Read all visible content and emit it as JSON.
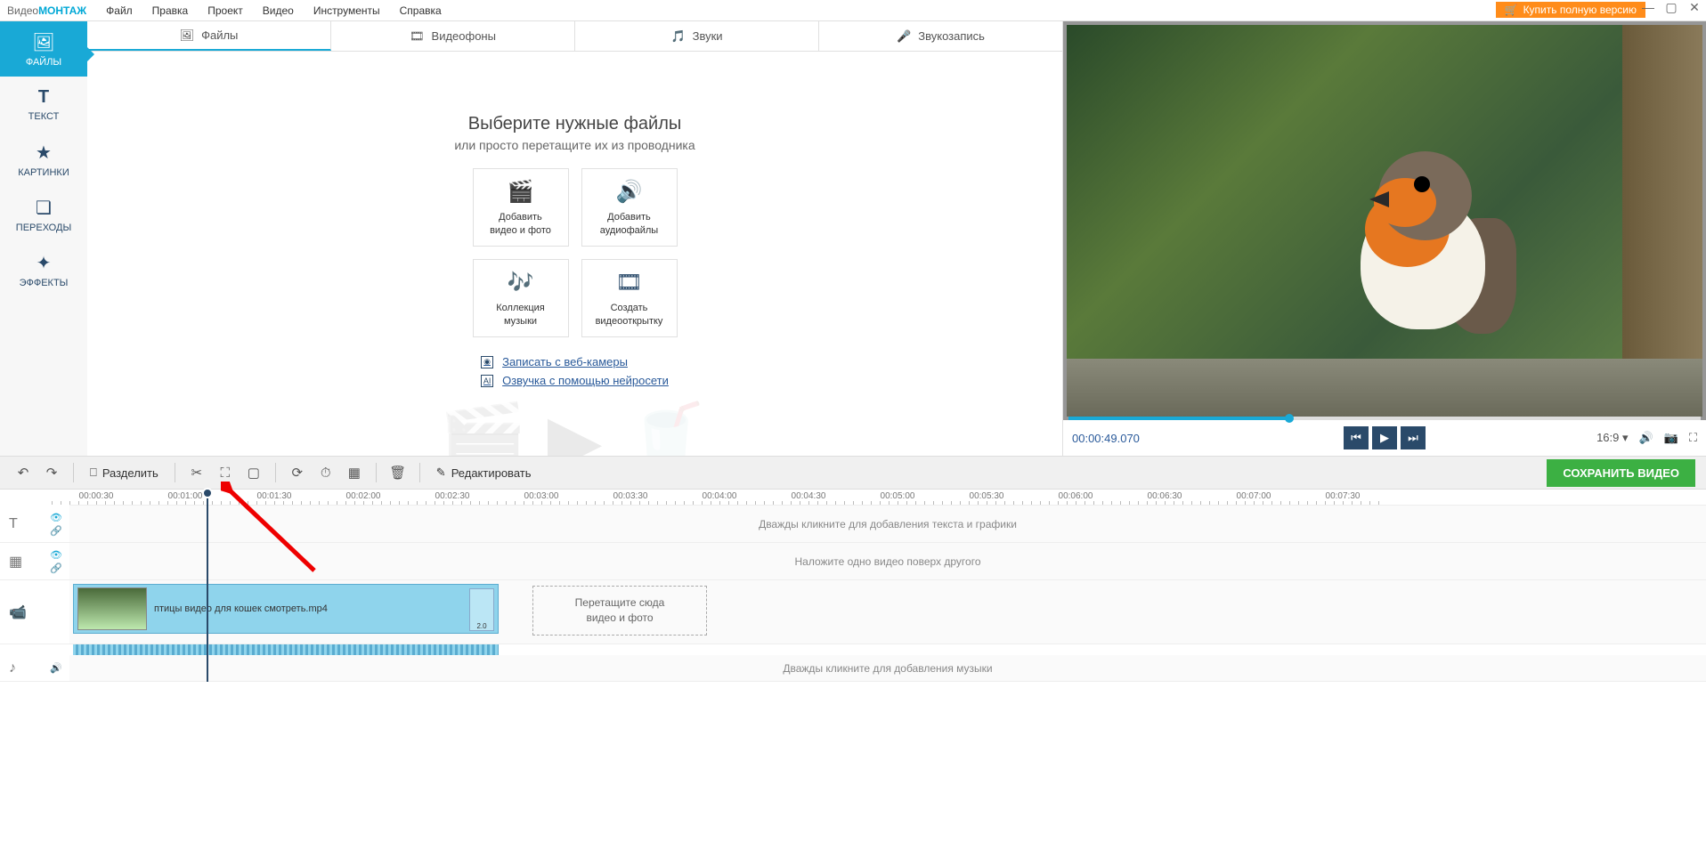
{
  "app": {
    "logo_part1": "Видео",
    "logo_part2": "МОНТАЖ"
  },
  "menu": {
    "file": "Файл",
    "edit": "Правка",
    "project": "Проект",
    "video": "Видео",
    "tools": "Инструменты",
    "help": "Справка"
  },
  "buy_button": "Купить полную версию",
  "sidebar": {
    "files": "ФАЙЛЫ",
    "text": "ТЕКСТ",
    "pictures": "КАРТИНКИ",
    "transitions": "ПЕРЕХОДЫ",
    "effects": "ЭФФЕКТЫ"
  },
  "tabs": {
    "files": "Файлы",
    "videobg": "Видеофоны",
    "sounds": "Звуки",
    "record": "Звукозапись"
  },
  "content": {
    "title": "Выберите нужные файлы",
    "subtitle": "или просто перетащите их из проводника",
    "card1_l1": "Добавить",
    "card1_l2": "видео и фото",
    "card2_l1": "Добавить",
    "card2_l2": "аудиофайлы",
    "card3_l1": "Коллекция",
    "card3_l2": "музыки",
    "card4_l1": "Создать",
    "card4_l2": "видеооткрытку",
    "link1": "Записать с веб-камеры",
    "link2": "Озвучка с помощью нейросети"
  },
  "preview": {
    "timestamp": "00:00:49.070",
    "aspect": "16:9"
  },
  "toolbar": {
    "split": "Разделить",
    "edit": "Редактировать",
    "save": "СОХРАНИТЬ ВИДЕО"
  },
  "ruler": [
    "00:00:30",
    "00:01:00",
    "00:01:30",
    "00:02:00",
    "00:02:30",
    "00:03:00",
    "00:03:30",
    "00:04:00",
    "00:04:30",
    "00:05:00",
    "00:05:30",
    "00:06:00",
    "00:06:30",
    "00:07:00",
    "00:07:30"
  ],
  "tracks": {
    "text_placeholder": "Дважды кликните для добавления текста и графики",
    "overlay_placeholder": "Наложите одно видео поверх другого",
    "music_placeholder": "Дважды кликните для добавления музыки",
    "clip_name": "птицы видео для кошек смотреть.mp4",
    "clip_end": "2.0",
    "drop_l1": "Перетащите сюда",
    "drop_l2": "видео и фото"
  }
}
